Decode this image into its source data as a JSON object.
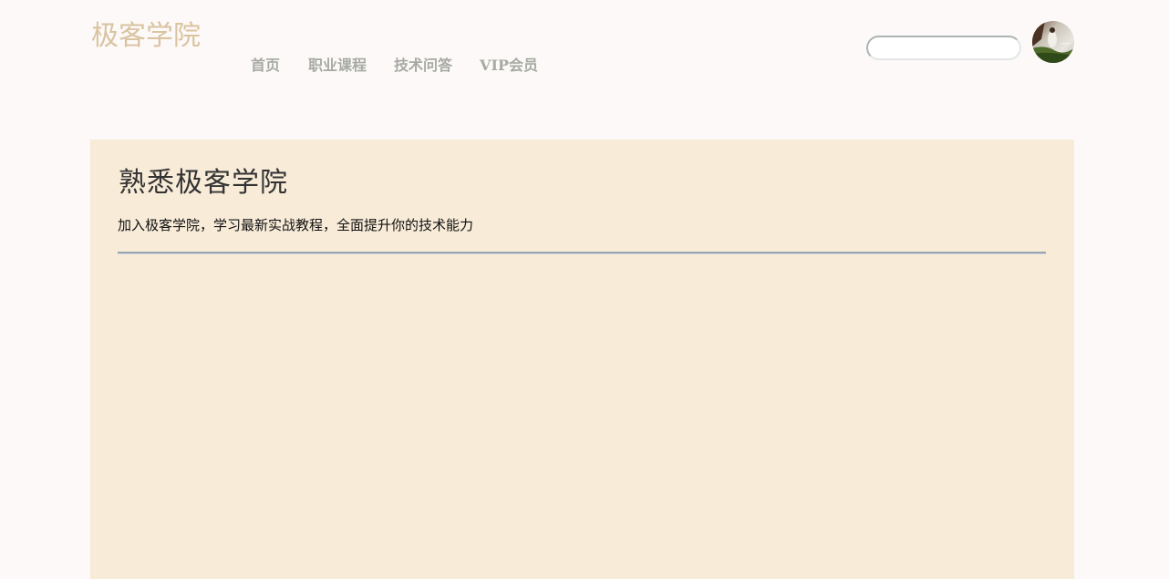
{
  "header": {
    "logo": "极客学院",
    "nav": [
      {
        "label": "首页"
      },
      {
        "label": "职业课程"
      },
      {
        "label": "技术问答"
      },
      {
        "label": "VIP会员"
      }
    ],
    "search": {
      "value": "",
      "placeholder": ""
    },
    "avatar_icon": "user-avatar-photo"
  },
  "hero": {
    "title": "熟悉极客学院",
    "description": "加入极客学院，学习最新实战教程，全面提升你的技术能力"
  },
  "colors": {
    "page_background": "#fdf9f9",
    "logo": "#d9c4a0",
    "nav_text": "#a6aaa2",
    "hero_background": "#f8ebd8",
    "hero_title": "#333333"
  }
}
